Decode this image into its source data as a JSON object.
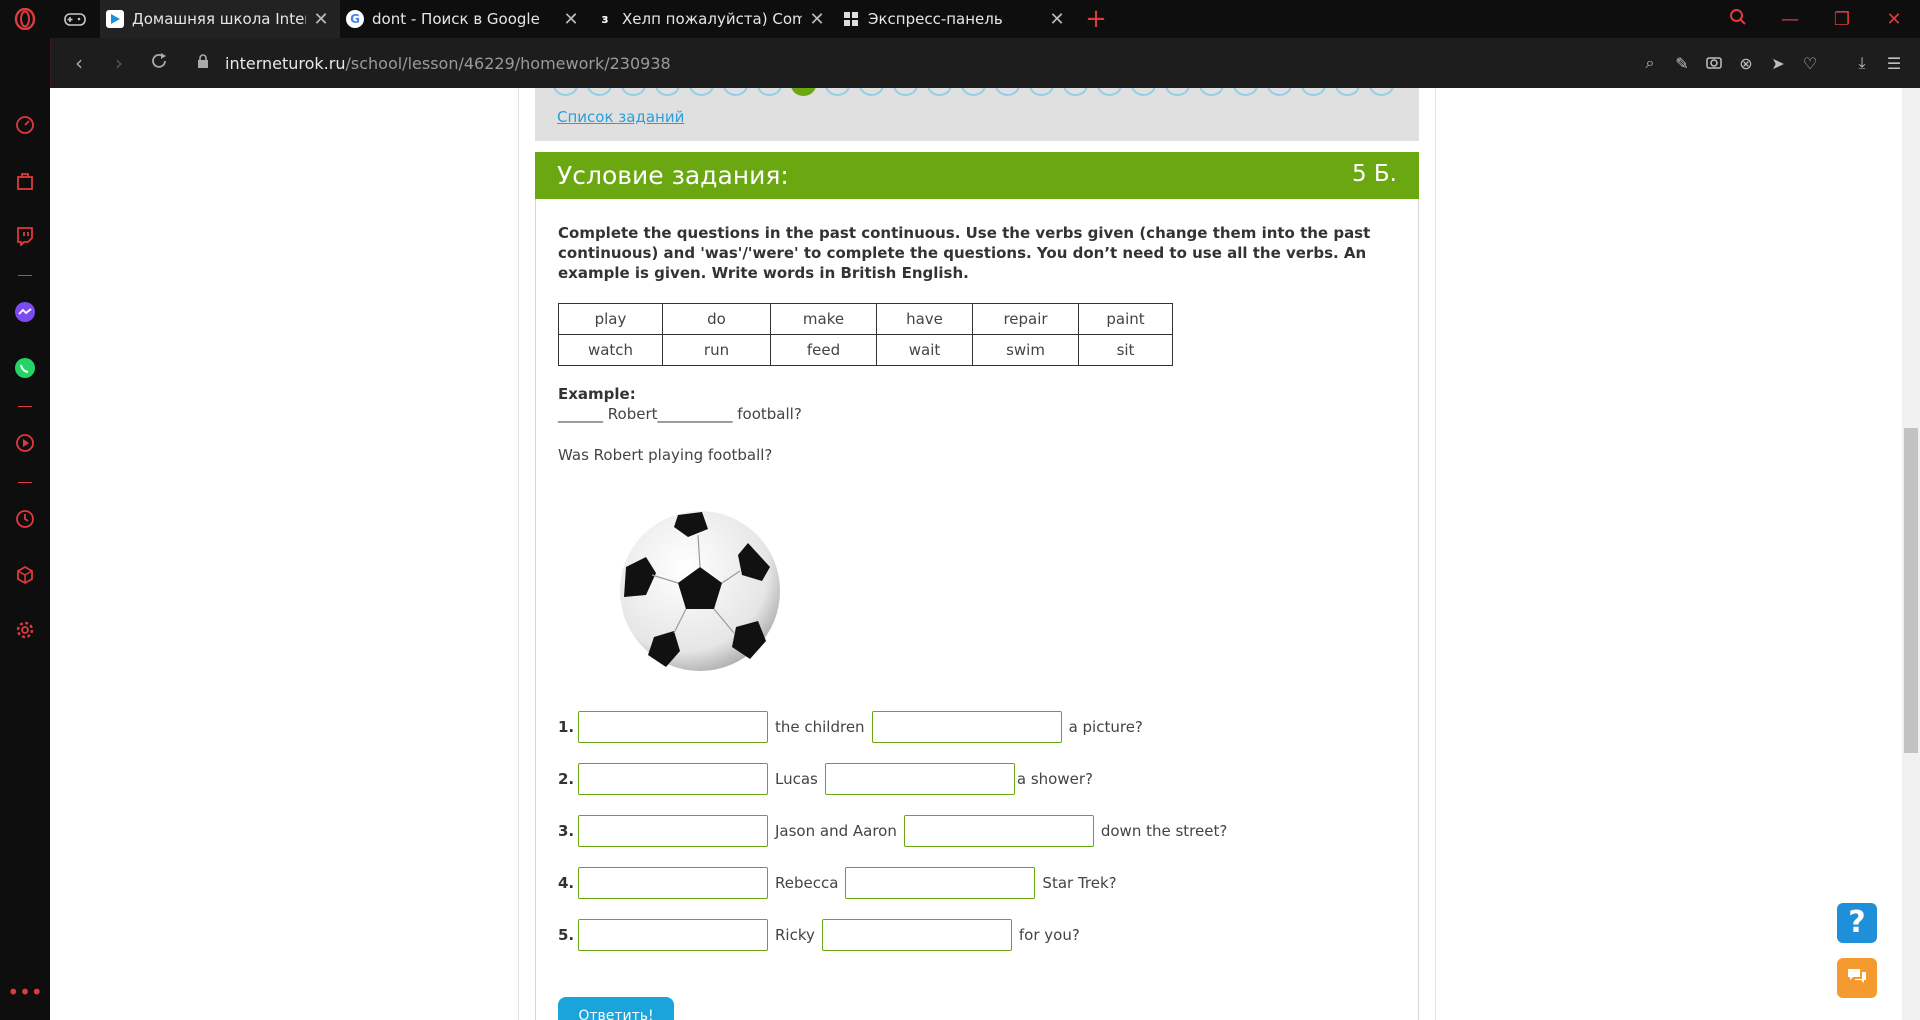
{
  "browser": {
    "tabs": [
      {
        "title": "Домашняя школа Interneturok",
        "favicon": "play-icon",
        "active": true
      },
      {
        "title": "dont - Поиск в Google",
        "favicon": "google-icon",
        "active": false
      },
      {
        "title": "Хелп пожалуйста) Complete",
        "favicon": "znanija-icon",
        "active": false
      },
      {
        "title": "Экспресс-панель",
        "favicon": "grid-icon",
        "active": false
      }
    ],
    "url_domain": "interneturok.ru",
    "url_path": "/school/lesson/46229/homework/230938",
    "accent_color": "#e0393e"
  },
  "page": {
    "task_list_link": "Список заданий",
    "condition_title": "Условие задания:",
    "score": "5 Б.",
    "instructions": "Complete the questions in the past continuous. Use the verbs given (change them into the past continuous) and 'was'/'were' to complete the questions. You don’t need to use all the verbs. An example is given. Write words in British English.",
    "verbs": [
      [
        "play",
        "do",
        "make",
        "have",
        "repair",
        "paint"
      ],
      [
        "watch",
        "run",
        "feed",
        "wait",
        "swim",
        "sit"
      ]
    ],
    "example_label": "Example:",
    "example_line": "______ Robert__________ football?",
    "example_answer": "Was Robert playing football?",
    "questions": [
      {
        "num": "1.",
        "mid": "the children",
        "end": "a picture?"
      },
      {
        "num": "2.",
        "mid": "Lucas",
        "end": "a shower?"
      },
      {
        "num": "3.",
        "mid": "Jason and Aaron",
        "end": "down the street?"
      },
      {
        "num": "4.",
        "mid": "Rebecca",
        "end": "Star Trek?"
      },
      {
        "num": "5.",
        "mid": "Ricky",
        "end": "for you?"
      }
    ],
    "answer_button": "Ответить!",
    "help_button": "?",
    "green_color": "#6aa710"
  }
}
